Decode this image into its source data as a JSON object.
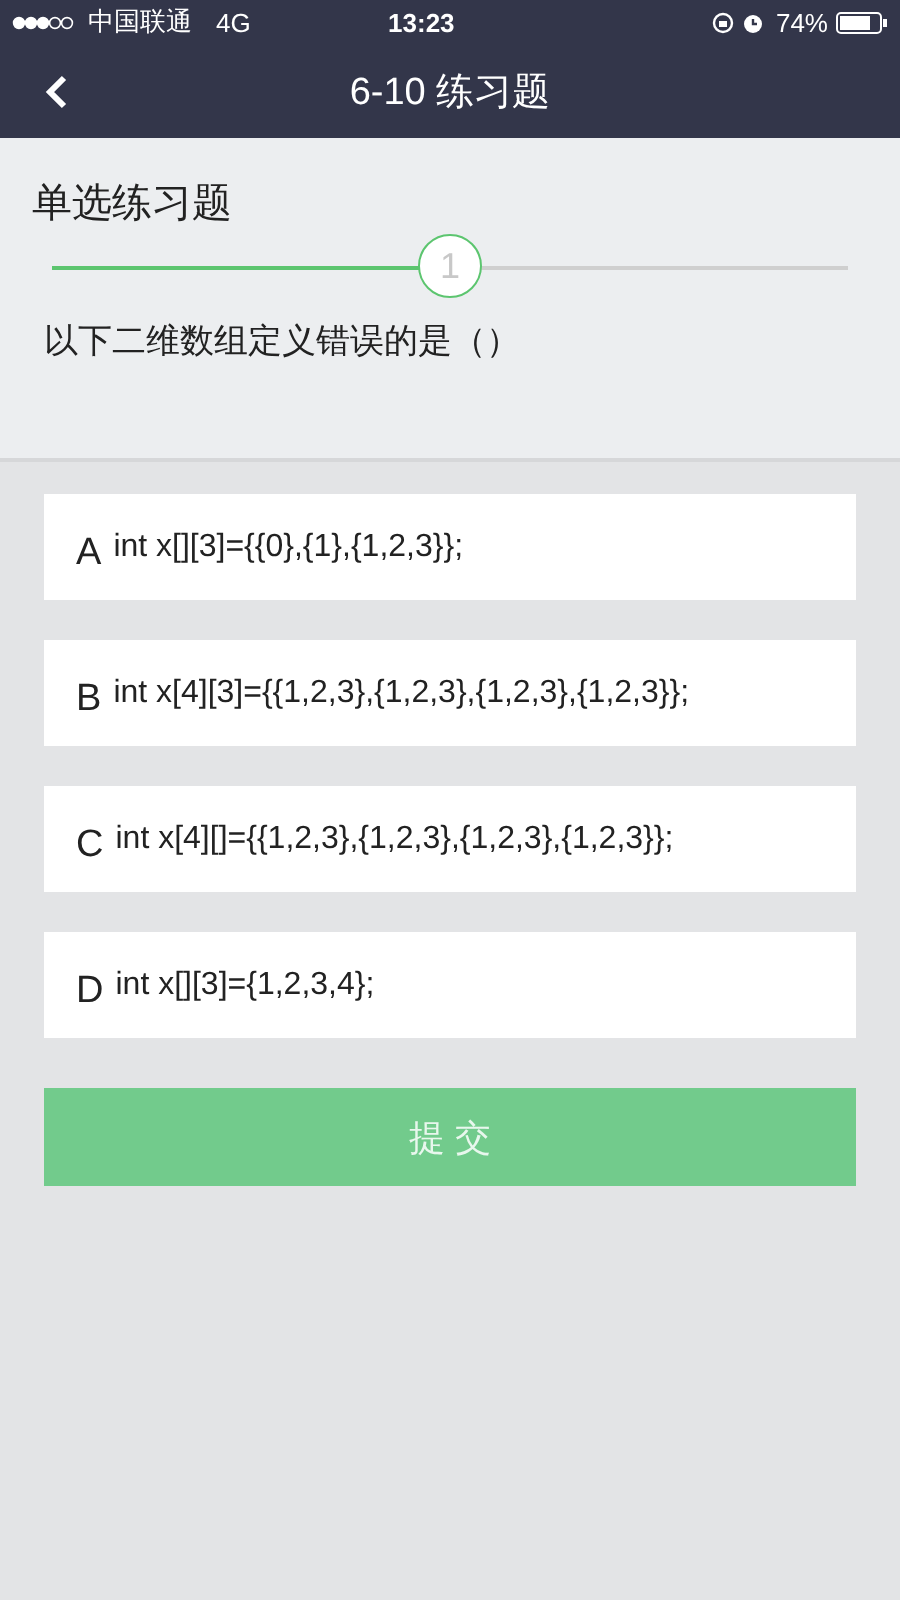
{
  "status_bar": {
    "carrier": "中国联通",
    "network": "4G",
    "time": "13:23",
    "battery": "74%"
  },
  "nav": {
    "title": "6-10 练习题"
  },
  "section_title": "单选练习题",
  "progress": {
    "level": 0.5,
    "step": "1"
  },
  "question": "以下二维数组定义错误的是（）",
  "options": [
    {
      "letter": "A",
      "text": "int x[][3]={{0},{1},{1,2,3}};",
      "selected": false
    },
    {
      "letter": "B",
      "text": "int x[4][3]={{1,2,3},{1,2,3},{1,2,3},{1,2,3}};",
      "selected": false
    },
    {
      "letter": "C",
      "text": "int x[4][]={{1,2,3},{1,2,3},{1,2,3},{1,2,3}};",
      "selected": false
    },
    {
      "letter": "D",
      "text": "int x[][3]={1,2,3,4};",
      "selected": false
    }
  ],
  "submit": {
    "label": "提 交",
    "disabled": false
  }
}
